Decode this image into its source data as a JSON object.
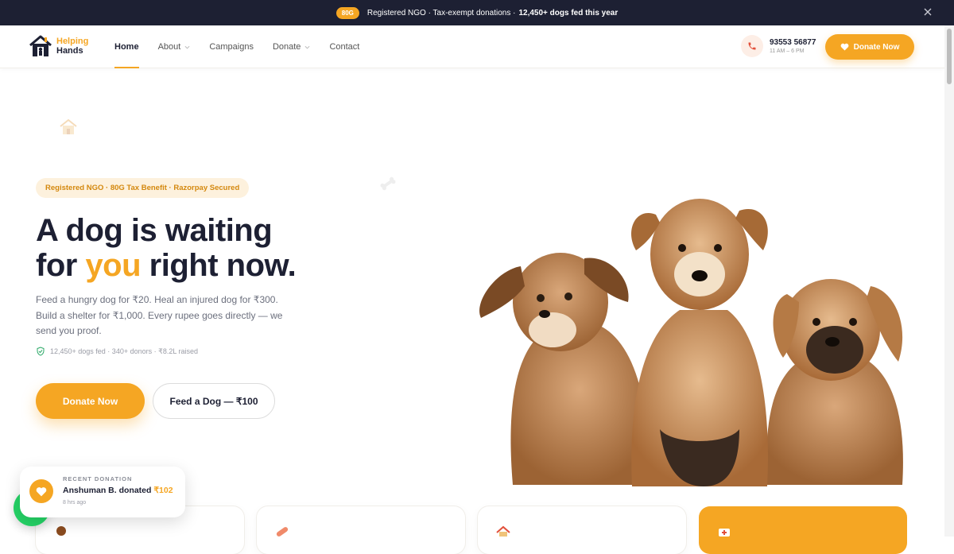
{
  "announcement": {
    "badge": "80G",
    "text": "Registered NGO · Tax-exempt donations ·",
    "highlight": "12,450+ dogs fed this year"
  },
  "brand": {
    "line1": "Helping",
    "line2": "Hands",
    "accent_color": "#f5a623",
    "dark_color": "#1d2033"
  },
  "nav": {
    "items": [
      {
        "label": "Home",
        "active": true,
        "dropdown": false
      },
      {
        "label": "About",
        "active": false,
        "dropdown": true
      },
      {
        "label": "Campaigns",
        "active": false,
        "dropdown": false
      },
      {
        "label": "Donate",
        "active": false,
        "dropdown": true
      },
      {
        "label": "Contact",
        "active": false,
        "dropdown": false
      }
    ],
    "phone": "93553 56877",
    "hours": "11 AM – 6 PM",
    "cta": "Donate Now"
  },
  "hero": {
    "pill": "Registered NGO · 80G Tax Benefit · Razorpay Secured",
    "title_line1": "A dog is waiting",
    "title_pre": "for ",
    "title_accent": "you",
    "title_post": " right now.",
    "lead": "Feed a hungry dog for ₹20. Heal an injured dog for ₹300. Build a shelter for ₹1,000. Every rupee goes directly — we send you proof.",
    "trust": "12,450+ dogs fed · 340+ donors · ₹8.2L raised",
    "primary_button": "Donate Now",
    "secondary_button": "Feed a Dog — ₹100"
  },
  "toast": {
    "label": "RECENT DONATION",
    "text": "Anshuman B. donated ",
    "amount": "₹102",
    "time": "8 hrs ago"
  },
  "icons": [
    "close-icon",
    "phone-icon",
    "heart-icon",
    "shield-check-icon",
    "house-icon",
    "bone-icon",
    "whatsapp-icon"
  ]
}
